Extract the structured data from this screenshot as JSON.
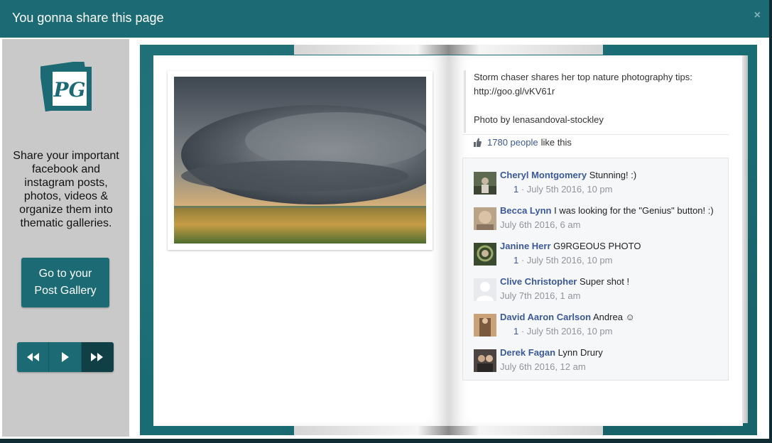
{
  "modal": {
    "title": "You gonna share this page",
    "close_label": "×"
  },
  "sidebar": {
    "logo_text": "PG",
    "tagline": "Share your important facebook and instagram posts, photos, videos & organize them into thematic galleries.",
    "gallery_button": {
      "line1": "Go to your",
      "line2": "Post Gallery"
    },
    "controls": [
      {
        "name": "rewind-icon"
      },
      {
        "name": "play-icon"
      },
      {
        "name": "fast-forward-icon"
      }
    ]
  },
  "post": {
    "text_line1": "Storm chaser shares her top nature photography tips:",
    "text_line2": "http://goo.gl/vKV61r",
    "text_line3": "Photo by lenasandoval-stockley",
    "likes_count": "1780 people",
    "likes_suffix": "like this"
  },
  "comments": [
    {
      "name": "Cheryl Montgomery",
      "text": "Stunning! :)",
      "likes": "1",
      "date": " · July 5th 2016, 10 pm"
    },
    {
      "name": "Becca Lynn",
      "text": "I was looking for the \"Genius\" button! :)",
      "likes": "",
      "date": "July 6th 2016, 6 am"
    },
    {
      "name": "Janine Herr",
      "text": "G9RGEOUS PHOTO",
      "likes": "1",
      "date": " · July 5th 2016, 10 pm"
    },
    {
      "name": "Clive Christopher",
      "text": "Super shot !",
      "likes": "",
      "date": "July 7th 2016, 1 am"
    },
    {
      "name": "David Aaron Carlson",
      "text": "Andrea ☺",
      "likes": "1",
      "date": " · July 5th 2016, 10 pm"
    },
    {
      "name": "Derek Fagan",
      "text": "Lynn Drury",
      "likes": "",
      "date": "July 6th 2016, 12 am"
    }
  ],
  "colors": {
    "brand_teal": "#1b6a74",
    "link_blue": "#3b5998"
  }
}
